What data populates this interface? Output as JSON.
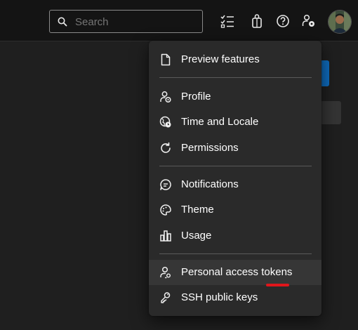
{
  "search": {
    "placeholder": "Search"
  },
  "toolbar": {
    "icons": [
      "task-list-icon",
      "shopping-bag-icon",
      "help-icon",
      "user-settings-icon"
    ]
  },
  "avatar": {
    "alt": "User avatar"
  },
  "menu": {
    "groups": [
      [
        {
          "label": "Preview features",
          "icon": "document-icon"
        }
      ],
      [
        {
          "label": "Profile",
          "icon": "profile-icon"
        },
        {
          "label": "Time and Locale",
          "icon": "globe-clock-icon"
        },
        {
          "label": "Permissions",
          "icon": "refresh-icon"
        }
      ],
      [
        {
          "label": "Notifications",
          "icon": "chat-bubble-icon"
        },
        {
          "label": "Theme",
          "icon": "palette-icon"
        },
        {
          "label": "Usage",
          "icon": "bar-chart-icon"
        }
      ],
      [
        {
          "label": "Personal access tokens",
          "icon": "person-key-icon"
        },
        {
          "label": "SSH public keys",
          "icon": "keys-icon"
        }
      ]
    ],
    "highlighted_item": "Personal access tokens"
  },
  "colors": {
    "background": "#1f1f1f",
    "topbar": "#141414",
    "menu": "#2a2a2a",
    "highlight": "#363636",
    "accent_blue": "#0f6cbd",
    "annotation_red": "#e0161b"
  }
}
